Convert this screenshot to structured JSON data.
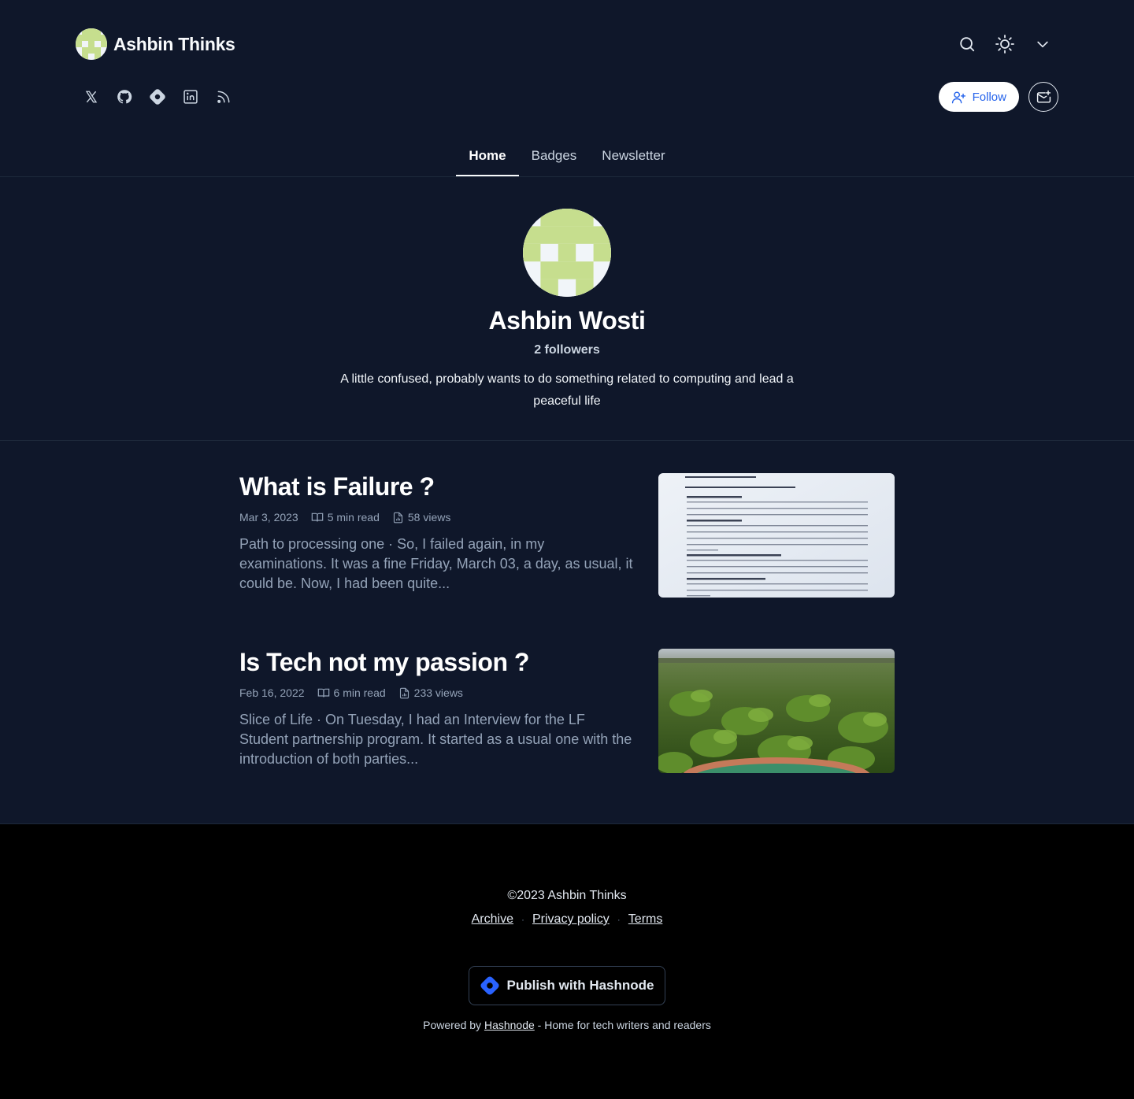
{
  "blog": {
    "title": "Ashbin Thinks"
  },
  "icons": {
    "search": "search-icon",
    "theme": "sun-icon",
    "menu": "chevron-down-icon",
    "socials": [
      "x-icon",
      "github-icon",
      "hashnode-icon",
      "linkedin-icon",
      "rss-icon"
    ]
  },
  "actions": {
    "follow_label": "Follow"
  },
  "nav": {
    "tabs": [
      "Home",
      "Badges",
      "Newsletter"
    ],
    "active": "Home"
  },
  "profile": {
    "name": "Ashbin Wosti",
    "followers": "2 followers",
    "bio": "A little confused, probably wants to do something related to computing and lead a peaceful life"
  },
  "posts": [
    {
      "title": "What is Failure ?",
      "date": "Mar 3, 2023",
      "read_time": "5 min read",
      "views": "58 views",
      "excerpt": "Path to processing one · So, I failed again, in my examinations. It was a fine Friday, March 03, a day, as usual, it could be. Now, I had been quite..."
    },
    {
      "title": "Is Tech not my passion ?",
      "date": "Feb 16, 2022",
      "read_time": "6 min read",
      "views": "233 views",
      "excerpt": "Slice of Life · On Tuesday, I had an Interview for the LF Student partnership program. It started as a usual one with the introduction of both parties..."
    }
  ],
  "footer": {
    "copyright": "©2023 Ashbin Thinks",
    "links": [
      "Archive",
      "Privacy policy",
      "Terms"
    ],
    "publish_label": "Publish with Hashnode",
    "powered_prefix": "Powered by",
    "powered_link": "Hashnode",
    "powered_suffix": "- Home for tech writers and readers"
  },
  "colors": {
    "background": "#0f172a",
    "footer_bg": "#000000",
    "accent": "#2563eb",
    "avatar_green": "#c6de8e"
  }
}
